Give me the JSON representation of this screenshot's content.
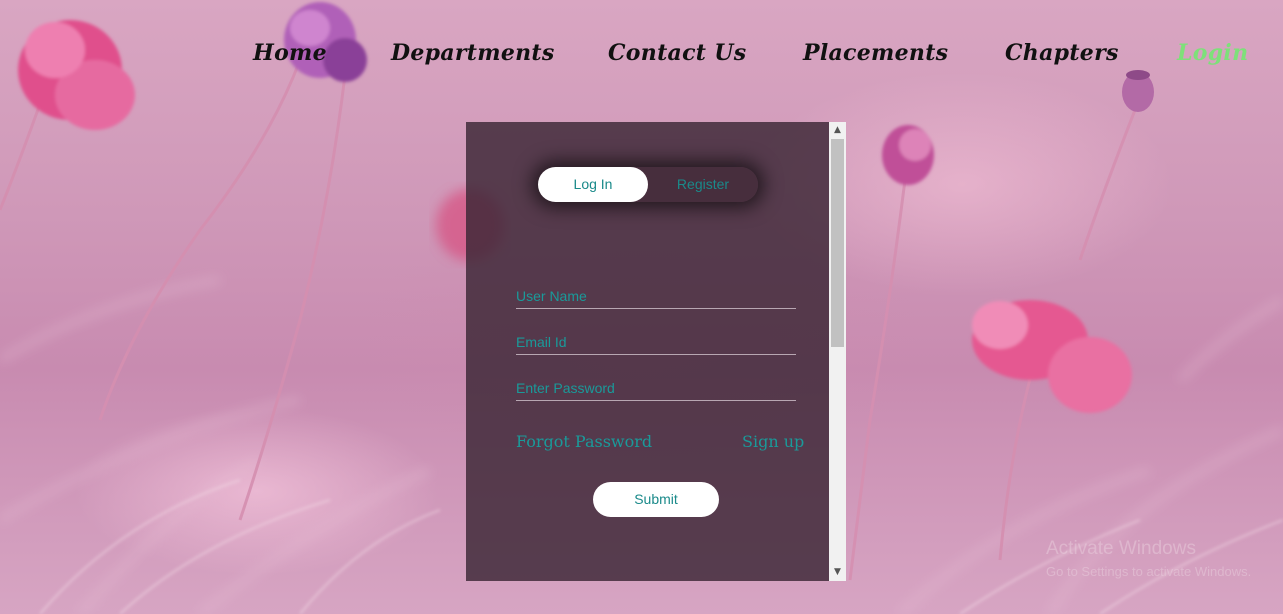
{
  "nav": {
    "items": [
      {
        "label": "Home"
      },
      {
        "label": "Departments"
      },
      {
        "label": "Contact Us"
      },
      {
        "label": "Placements"
      },
      {
        "label": "Chapters"
      },
      {
        "label": "Login"
      }
    ],
    "active_color": "#7ee07a"
  },
  "form": {
    "tabs": {
      "login": "Log In",
      "register": "Register"
    },
    "fields": {
      "username_placeholder": "User Name",
      "email_placeholder": "Email Id",
      "password_placeholder": "Enter Password"
    },
    "forgot_password": "Forgot Password",
    "sign_up": "Sign up",
    "submit": "Submit",
    "accent_color": "#1a9a9a"
  },
  "watermark": {
    "title": "Activate Windows",
    "subtitle": "Go to Settings to activate Windows."
  }
}
